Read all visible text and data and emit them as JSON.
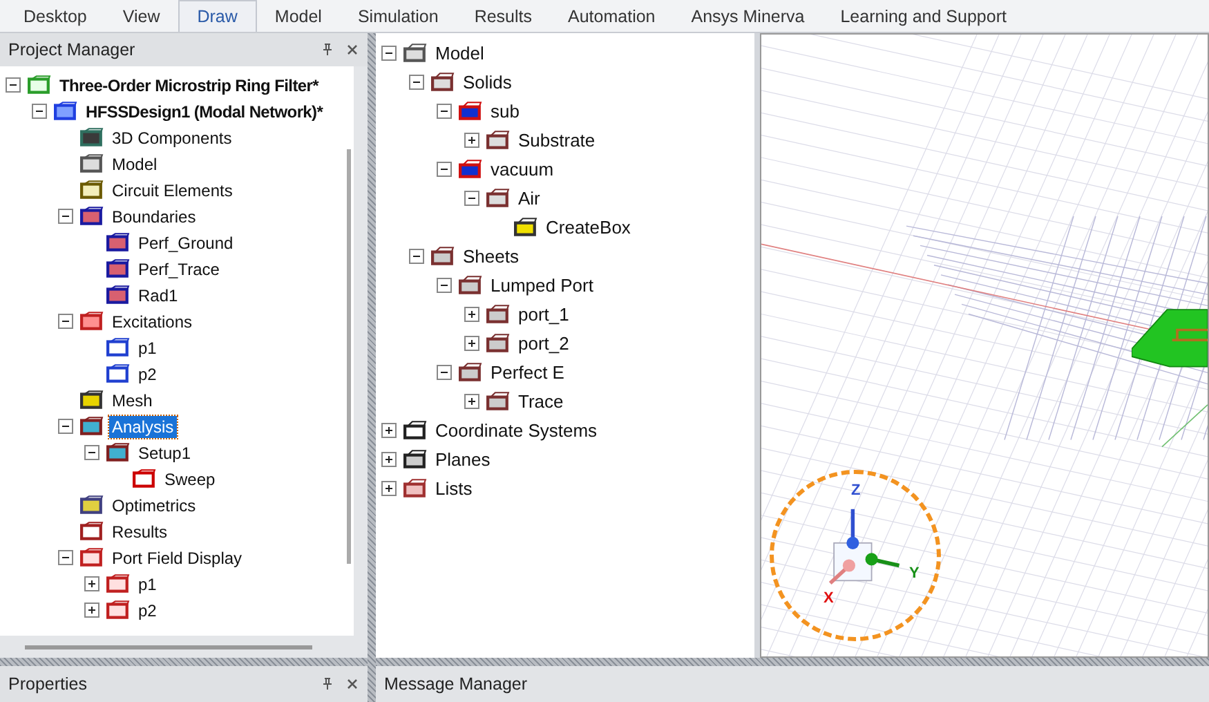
{
  "ribbon_tabs": [
    {
      "label": "Desktop",
      "selected": false
    },
    {
      "label": "View",
      "selected": false
    },
    {
      "label": "Draw",
      "selected": true
    },
    {
      "label": "Model",
      "selected": false
    },
    {
      "label": "Simulation",
      "selected": false
    },
    {
      "label": "Results",
      "selected": false
    },
    {
      "label": "Automation",
      "selected": false
    },
    {
      "label": "Ansys Minerva",
      "selected": false
    },
    {
      "label": "Learning and Support",
      "selected": false
    }
  ],
  "project_manager": {
    "title": "Project Manager",
    "tree": [
      {
        "label": "Three-Order Microstrip Ring Filter*",
        "kind": "project",
        "expanded": true,
        "selected": false,
        "children": [
          {
            "label": "HFSSDesign1 (Modal Network)*",
            "kind": "design",
            "expanded": true,
            "selected": false,
            "children": [
              {
                "label": "3D Components",
                "kind": "component",
                "selected": false
              },
              {
                "label": "Model",
                "kind": "model",
                "selected": false
              },
              {
                "label": "Circuit Elements",
                "kind": "circuit",
                "selected": false
              },
              {
                "label": "Boundaries",
                "kind": "boundary",
                "expanded": true,
                "selected": false,
                "children": [
                  {
                    "label": "Perf_Ground",
                    "kind": "boundary",
                    "selected": false
                  },
                  {
                    "label": "Perf_Trace",
                    "kind": "boundary",
                    "selected": false
                  },
                  {
                    "label": "Rad1",
                    "kind": "boundary",
                    "selected": false
                  }
                ]
              },
              {
                "label": "Excitations",
                "kind": "excitation",
                "expanded": true,
                "selected": false,
                "children": [
                  {
                    "label": "p1",
                    "kind": "port",
                    "selected": false
                  },
                  {
                    "label": "p2",
                    "kind": "port",
                    "selected": false
                  }
                ]
              },
              {
                "label": "Mesh",
                "kind": "mesh",
                "selected": false
              },
              {
                "label": "Analysis",
                "kind": "analysis",
                "expanded": true,
                "selected": true,
                "children": [
                  {
                    "label": "Setup1",
                    "kind": "analysis",
                    "expanded": true,
                    "selected": false,
                    "children": [
                      {
                        "label": "Sweep",
                        "kind": "sweep",
                        "selected": false
                      }
                    ]
                  }
                ]
              },
              {
                "label": "Optimetrics",
                "kind": "optimetrics",
                "selected": false
              },
              {
                "label": "Results",
                "kind": "results",
                "selected": false
              },
              {
                "label": "Port Field Display",
                "kind": "field",
                "expanded": true,
                "selected": false,
                "children": [
                  {
                    "label": "p1",
                    "kind": "field",
                    "expanded": false,
                    "selected": false
                  },
                  {
                    "label": "p2",
                    "kind": "field",
                    "expanded": false,
                    "selected": false
                  }
                ]
              }
            ]
          }
        ]
      }
    ]
  },
  "model_tree": [
    {
      "label": "Model",
      "kind": "model",
      "expanded": true,
      "selected": false,
      "children": [
        {
          "label": "Solids",
          "kind": "solid",
          "expanded": true,
          "selected": false,
          "children": [
            {
              "label": "sub",
              "kind": "material",
              "expanded": true,
              "selected": false,
              "children": [
                {
                  "label": "Substrate",
                  "kind": "solid",
                  "expanded": false,
                  "selected": false
                }
              ]
            },
            {
              "label": "vacuum",
              "kind": "material",
              "expanded": true,
              "selected": false,
              "children": [
                {
                  "label": "Air",
                  "kind": "solid",
                  "expanded": true,
                  "selected": false,
                  "children": [
                    {
                      "label": "CreateBox",
                      "kind": "box",
                      "selected": false
                    }
                  ]
                }
              ]
            }
          ]
        },
        {
          "label": "Sheets",
          "kind": "sheet",
          "expanded": true,
          "selected": false,
          "children": [
            {
              "label": "Lumped Port",
              "kind": "sheet",
              "expanded": true,
              "selected": false,
              "children": [
                {
                  "label": "port_1",
                  "kind": "sheet",
                  "expanded": false,
                  "selected": false
                },
                {
                  "label": "port_2",
                  "kind": "sheet",
                  "expanded": false,
                  "selected": false
                }
              ]
            },
            {
              "label": "Perfect E",
              "kind": "sheet",
              "expanded": true,
              "selected": false,
              "children": [
                {
                  "label": "Trace",
                  "kind": "sheet",
                  "expanded": false,
                  "selected": false
                }
              ]
            }
          ]
        }
      ]
    },
    {
      "label": "Coordinate Systems",
      "kind": "coords",
      "expanded": false,
      "selected": false
    },
    {
      "label": "Planes",
      "kind": "planes",
      "expanded": false,
      "selected": false
    },
    {
      "label": "Lists",
      "kind": "lists",
      "expanded": false,
      "selected": false
    }
  ],
  "viewport": {
    "axis_labels": {
      "x": "X",
      "y": "Y",
      "z": "Z"
    }
  },
  "properties": {
    "title": "Properties"
  },
  "message_manager": {
    "title": "Message Manager"
  }
}
